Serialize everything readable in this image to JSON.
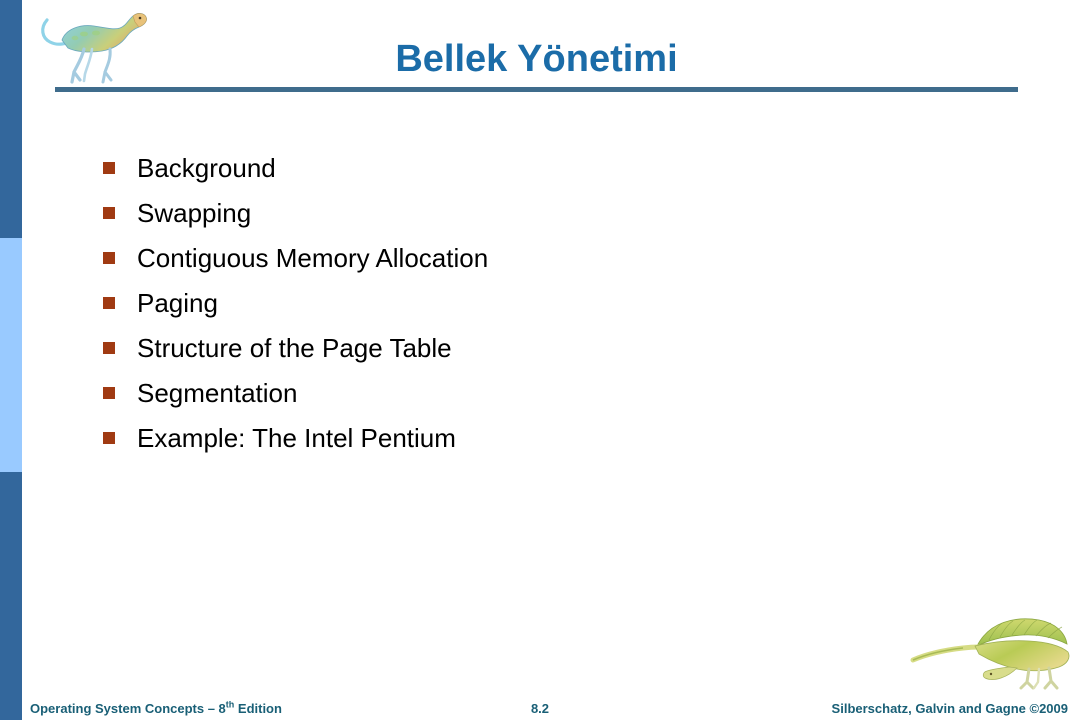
{
  "slide": {
    "title": "Bellek Yönetimi",
    "title_color": "#1b6ca8",
    "rule_color": "#3f6c8c",
    "background_color": "#ffffff",
    "bullet_marker_color": "#a03a12",
    "bullet_text_color": "#000000"
  },
  "sidebar": {
    "bands": [
      {
        "name": "top-band",
        "color": "#33679c"
      },
      {
        "name": "middle-band",
        "color": "#99caff"
      },
      {
        "name": "bottom-band",
        "color": "#33679c"
      }
    ]
  },
  "decor": {
    "top_left_image": "dinosaur-illustration",
    "bottom_right_image": "sail-backed-dinosaur-illustration"
  },
  "bullets": [
    {
      "label": "Background"
    },
    {
      "label": "Swapping"
    },
    {
      "label": "Contiguous Memory Allocation"
    },
    {
      "label": "Paging"
    },
    {
      "label": "Structure of the Page Table"
    },
    {
      "label": "Segmentation"
    },
    {
      "label": "Example: The Intel Pentium"
    }
  ],
  "footer": {
    "left_text": "Operating System Concepts – 8",
    "left_superscript": "th",
    "left_text_tail": " Edition",
    "page_number": "8.2",
    "right_text": "Silberschatz, Galvin and Gagne ©2009",
    "text_color": "#195f76"
  }
}
